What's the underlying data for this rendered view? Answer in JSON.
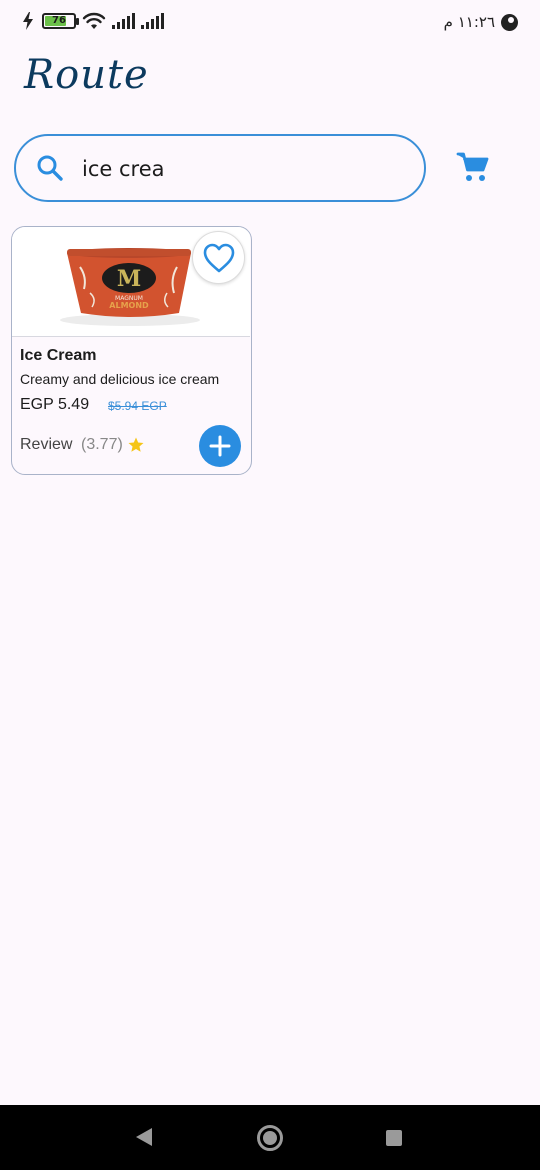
{
  "status_bar": {
    "battery_level": "76",
    "battery_fraction": 0.76,
    "time": "١١:٢٦ م",
    "icons": [
      "charging-icon",
      "battery-icon",
      "wifi-icon",
      "signal-icon",
      "signal-icon",
      "app-notification-icon"
    ]
  },
  "header": {
    "logo_text": "Route"
  },
  "search": {
    "value": "ice crea",
    "placeholder": ""
  },
  "product": {
    "title": "Ice Cream",
    "description": "Creamy and delicious ice cream",
    "price": "EGP 5.49",
    "old_price": "$5.94 EGP",
    "review_label": "Review",
    "rating": "(3.77)",
    "image_brand_label": "MAGNUM"
  },
  "colors": {
    "accent": "#2a8de0",
    "border": "#3a8fd8",
    "star": "#f5c518",
    "background": "#fdf8fd"
  }
}
